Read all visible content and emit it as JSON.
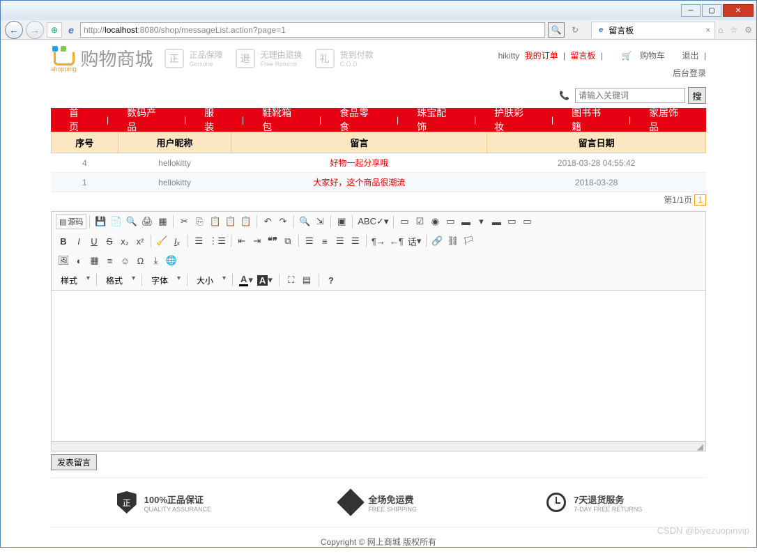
{
  "browser": {
    "url_pre": "http://",
    "url_host": "localhost",
    "url_rest": ":8080/shop/messageList.action?page=1",
    "tab_title": "留言板"
  },
  "top": {
    "user": "hikitty",
    "my_orders": "我的订单",
    "msg_board": "留言板",
    "cart": "购物车",
    "logout": "退出",
    "backend": "后台登录"
  },
  "logo": {
    "title": "购物商城",
    "sub": "shopping"
  },
  "guarantees": [
    {
      "t": "正品保障",
      "s": "Genuine",
      "i": "正"
    },
    {
      "t": "无理由退换",
      "s": "Free Returns",
      "i": "退"
    },
    {
      "t": "货到付款",
      "s": "C.O.D",
      "i": "礼"
    }
  ],
  "search": {
    "placeholder": "请输入关键词",
    "btn": "搜"
  },
  "nav": [
    "首页",
    "数码产品",
    "服装",
    "鞋靴箱包",
    "食品零食",
    "珠宝配饰",
    "护肤彩妆",
    "图书书籍",
    "家居饰品"
  ],
  "table": {
    "headers": [
      "序号",
      "用户昵称",
      "留言",
      "留言日期"
    ],
    "rows": [
      {
        "id": "4",
        "nick": "hellokitty",
        "msg": "好物一起分享哦",
        "date": "2018-03-28 04:55:42"
      },
      {
        "id": "1",
        "nick": "hellokitty",
        "msg": "大家好，这个商品很潮流",
        "date": "2018-03-28"
      }
    ]
  },
  "pager": {
    "text": "第1/1页",
    "cur": "1"
  },
  "editor": {
    "source": "源码",
    "styles": "样式",
    "format": "格式",
    "font": "字体",
    "size": "大小",
    "lang": "话"
  },
  "submit": "发表留言",
  "features": [
    {
      "t": "100%正品保证",
      "s": "QUALITY ASSURANCE"
    },
    {
      "t": "全场免运费",
      "s": "FREE SHIPPING"
    },
    {
      "t": "7天退货服务",
      "s": "7-DAY FREE RETURNS"
    }
  ],
  "copyright": "Copyright © 网上商城 版权所有",
  "watermark": "CSDN @biyezuopinvip"
}
